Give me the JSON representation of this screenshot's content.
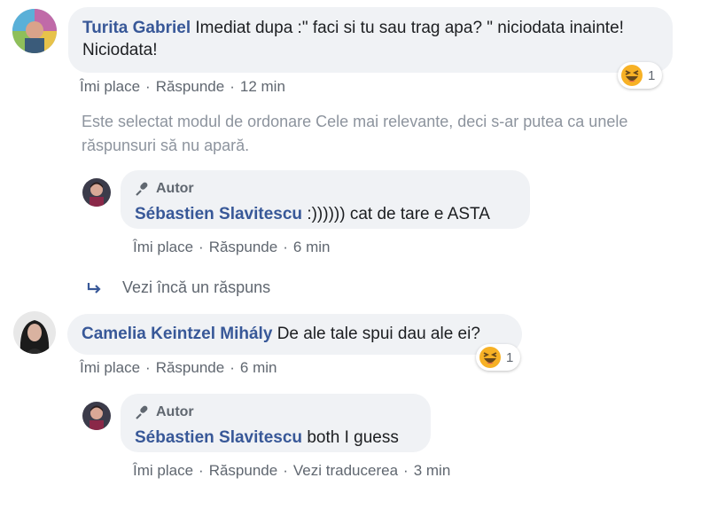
{
  "comment1": {
    "author": "Turita Gabriel",
    "text": "Imediat dupa :\" faci si tu sau trag apa? \" niciodata inainte! Niciodata!",
    "like_label": "Îmi place",
    "reply_label": "Răspunde",
    "time": "12 min",
    "reaction_count": "1"
  },
  "notice": "Este selectat modul de ordonare Cele mai relevante, deci s-ar putea ca unele răspunsuri să nu apară.",
  "reply1": {
    "badge": "Autor",
    "author": "Sébastien Slavitescu",
    "text": ":)))))) cat de tare e ASTA",
    "like_label": "Îmi place",
    "reply_label": "Răspunde",
    "time": "6 min"
  },
  "more_replies": "Vezi încă un răspuns",
  "comment2": {
    "author": "Camelia Keintzel Mihály",
    "text": "De ale tale spui dau ale ei?",
    "like_label": "Îmi place",
    "reply_label": "Răspunde",
    "time": "6 min",
    "reaction_count": "1"
  },
  "reply2": {
    "badge": "Autor",
    "author": "Sébastien Slavitescu",
    "text": "both I guess",
    "like_label": "Îmi place",
    "reply_label": "Răspunde",
    "translate_label": "Vezi traducerea",
    "time": "3 min"
  },
  "icons": {
    "reaction": "laughing-emoji-icon",
    "author_badge": "microphone-icon",
    "reply_arrow": "reply-arrow-icon"
  },
  "colors": {
    "name": "#385898",
    "bubble": "#f0f2f5",
    "meta": "#606770",
    "notice": "#8d949e",
    "emoji": "#f7b125"
  }
}
